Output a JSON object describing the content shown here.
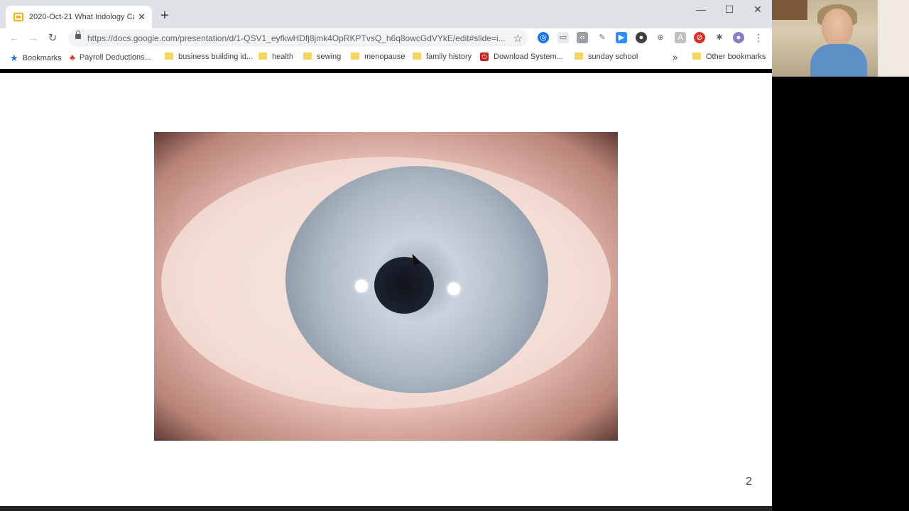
{
  "browser": {
    "tab": {
      "title": "2020-Oct-21 What Iridology Can",
      "close": "✕"
    },
    "new_tab": "+",
    "window_controls": {
      "minimize": "—",
      "maximize": "☐",
      "close": "✕"
    },
    "nav": {
      "back": "←",
      "forward": "→",
      "reload": "↻"
    },
    "url": "https://docs.google.com/presentation/d/1-QSV1_eyfkwHDfj8jmk4OpRKPTvsQ_h6q8owcGdVYkE/edit#slide=i...",
    "star": "☆",
    "menu": "⋮",
    "bookmarks": [
      {
        "label": "Bookmarks",
        "icon": "star-icon"
      },
      {
        "label": "Payroll Deductions...",
        "icon": "maple-leaf-icon"
      },
      {
        "label": "business building id...",
        "icon": "folder-icon"
      },
      {
        "label": "health",
        "icon": "folder-icon"
      },
      {
        "label": "sewing",
        "icon": "folder-icon"
      },
      {
        "label": "menopause",
        "icon": "folder-icon"
      },
      {
        "label": "family history",
        "icon": "folder-icon"
      },
      {
        "label": "Download System...",
        "icon": "power-icon"
      },
      {
        "label": "sunday school",
        "icon": "folder-icon"
      }
    ],
    "overflow": "»",
    "other_bookmarks": "Other bookmarks"
  },
  "slide": {
    "number": "2",
    "image_description_icon": "eye-iris-photo"
  },
  "colors": {
    "tabstrip": "#dee1e6",
    "folder": "#f6d55c",
    "accent": "#1a73e8"
  }
}
